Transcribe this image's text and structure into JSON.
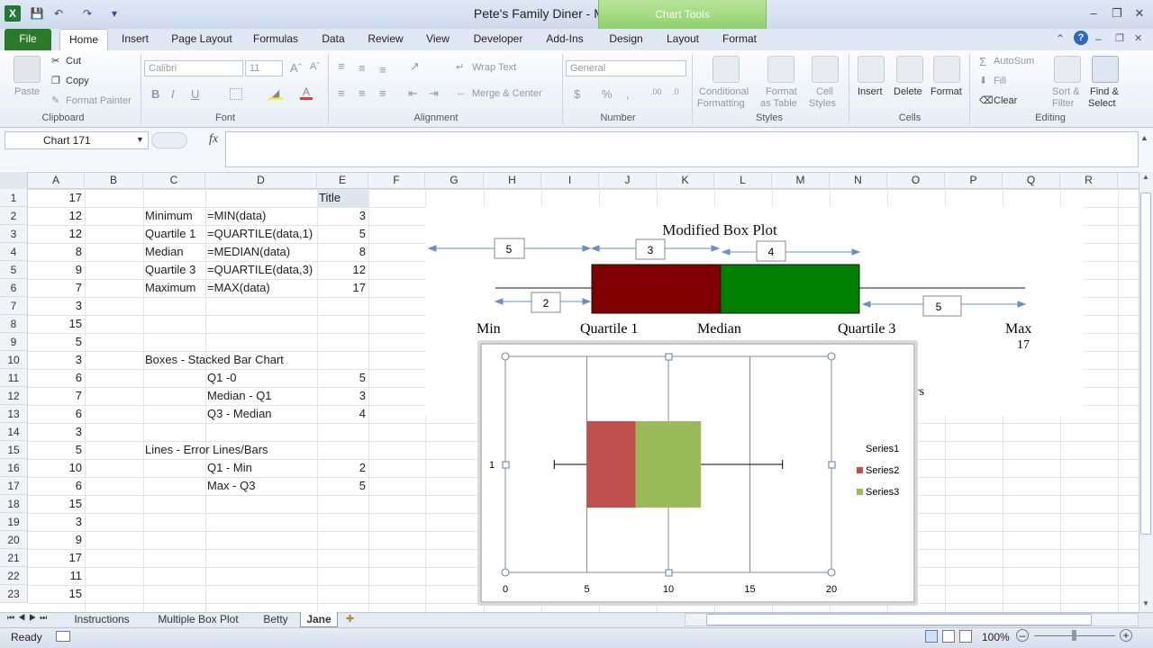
{
  "window": {
    "title": "Pete's Family Diner  -  Microsoft Excel",
    "context_tab": "Chart Tools"
  },
  "tabs": [
    "File",
    "Home",
    "Insert",
    "Page Layout",
    "Formulas",
    "Data",
    "Review",
    "View",
    "Developer",
    "Add-Ins",
    "Design",
    "Layout",
    "Format"
  ],
  "ribbon": {
    "clipboard": {
      "label": "Clipboard",
      "paste": "Paste",
      "cut": "Cut",
      "copy": "Copy",
      "format_painter": "Format Painter"
    },
    "font": {
      "label": "Font",
      "family": "Calibri",
      "size": "11"
    },
    "alignment": {
      "label": "Alignment",
      "wrap": "Wrap Text",
      "merge": "Merge & Center"
    },
    "number": {
      "label": "Number",
      "format": "General"
    },
    "styles": {
      "label": "Styles",
      "conditional": "Conditional",
      "conditional2": "Formatting",
      "format_table": "Format",
      "format_table2": "as Table",
      "cell_styles": "Cell",
      "cell_styles2": "Styles"
    },
    "cells": {
      "label": "Cells",
      "insert": "Insert",
      "delete": "Delete",
      "format": "Format"
    },
    "editing": {
      "label": "Editing",
      "autosum": "AutoSum",
      "fill": "Fill",
      "clear": "Clear",
      "sort": "Sort &",
      "sort2": "Filter",
      "find": "Find &",
      "find2": "Select"
    }
  },
  "formula_bar": {
    "name_box": "Chart 171",
    "fx": "fx",
    "formula": ""
  },
  "columns": [
    "A",
    "B",
    "C",
    "D",
    "E",
    "F",
    "G",
    "H",
    "I",
    "J",
    "K",
    "L",
    "M",
    "N",
    "O",
    "P",
    "Q",
    "R"
  ],
  "rows": [
    "1",
    "2",
    "3",
    "4",
    "5",
    "6",
    "7",
    "8",
    "9",
    "10",
    "11",
    "12",
    "13",
    "14",
    "15",
    "16",
    "17",
    "18",
    "19",
    "20",
    "21",
    "22",
    "23"
  ],
  "cells": {
    "colA": [
      "17",
      "12",
      "12",
      "8",
      "9",
      "7",
      "3",
      "15",
      "5",
      "3",
      "6",
      "7",
      "6",
      "3",
      "5",
      "10",
      "6",
      "15",
      "3",
      "9",
      "17",
      "11",
      "15"
    ],
    "C2": "Minimum",
    "C3": "Quartile 1",
    "C4": "Median",
    "C5": "Quartile 3",
    "C6": "Maximum",
    "D2": "=MIN(data)",
    "D3": "=QUARTILE(data,1)",
    "D4": "=MEDIAN(data)",
    "D5": "=QUARTILE(data,3)",
    "D6": "=MAX(data)",
    "E1": "Title",
    "E2": "3",
    "E3": "5",
    "E4": "8",
    "E5": "12",
    "E6": "17",
    "C10": "Boxes - Stacked Bar Chart",
    "D11": "Q1 -0",
    "D12": "Median - Q1",
    "D13": "Q3 - Median",
    "E11": "5",
    "E12": "3",
    "E13": "4",
    "C15": "Lines - Error Lines/Bars",
    "D16": "Q1 - Min",
    "D17": "Max - Q3",
    "E16": "2",
    "E17": "5"
  },
  "back_chart": {
    "title": "Modified Box Plot",
    "labels": {
      "min": "Min",
      "q1": "Quartile 1",
      "median": "Median",
      "q3": "Quartile 3",
      "max": "Max",
      "max_val": "17",
      "partial": "rs"
    },
    "arrow_labels": [
      "5",
      "3",
      "4",
      "2",
      "5"
    ],
    "colors": {
      "box1": "#7f0000",
      "box2": "#008000"
    }
  },
  "chart_data": {
    "type": "bar",
    "orientation": "horizontal",
    "stacked": true,
    "categories": [
      "1"
    ],
    "series": [
      {
        "name": "Series1",
        "values": [
          5
        ],
        "color": "none"
      },
      {
        "name": "Series2",
        "values": [
          3
        ],
        "color": "#c0504d"
      },
      {
        "name": "Series3",
        "values": [
          4
        ],
        "color": "#9bbb59"
      }
    ],
    "error_bars": {
      "minus": 2,
      "plus": 5
    },
    "xlim": [
      0,
      20
    ],
    "xticks": [
      "0",
      "5",
      "10",
      "15",
      "20"
    ],
    "grid": "vertical major",
    "legend": "right"
  },
  "sheets": [
    "Instructions",
    "Multiple Box Plot",
    "Betty",
    "Jane"
  ],
  "active_sheet": "Jane",
  "status": {
    "ready": "Ready",
    "zoom": "100%"
  }
}
